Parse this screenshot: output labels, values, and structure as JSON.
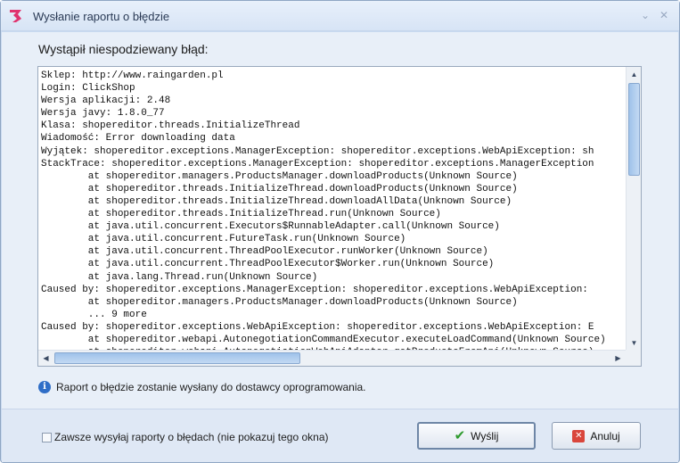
{
  "window": {
    "title": "Wysłanie raportu o błędzie",
    "minimize_glyph": "⌄",
    "close_glyph": "✕"
  },
  "heading": "Wystąpił niespodziewany błąd:",
  "report_lines": [
    "Sklep: http://www.raingarden.pl",
    "Login: ClickShop",
    "Wersja aplikacji: 2.48",
    "Wersja javy: 1.8.0_77",
    "Klasa: shopereditor.threads.InitializeThread",
    "Wiadomość: Error downloading data",
    "Wyjątek: shopereditor.exceptions.ManagerException: shopereditor.exceptions.WebApiException: sh",
    "StackTrace: shopereditor.exceptions.ManagerException: shopereditor.exceptions.ManagerException",
    "        at shopereditor.managers.ProductsManager.downloadProducts(Unknown Source)",
    "        at shopereditor.threads.InitializeThread.downloadProducts(Unknown Source)",
    "        at shopereditor.threads.InitializeThread.downloadAllData(Unknown Source)",
    "        at shopereditor.threads.InitializeThread.run(Unknown Source)",
    "        at java.util.concurrent.Executors$RunnableAdapter.call(Unknown Source)",
    "        at java.util.concurrent.FutureTask.run(Unknown Source)",
    "        at java.util.concurrent.ThreadPoolExecutor.runWorker(Unknown Source)",
    "        at java.util.concurrent.ThreadPoolExecutor$Worker.run(Unknown Source)",
    "        at java.lang.Thread.run(Unknown Source)",
    "Caused by: shopereditor.exceptions.ManagerException: shopereditor.exceptions.WebApiException:",
    "        at shopereditor.managers.ProductsManager.downloadProducts(Unknown Source)",
    "        ... 9 more",
    "Caused by: shopereditor.exceptions.WebApiException: shopereditor.exceptions.WebApiException: E",
    "        at shopereditor.webapi.AutonegotiationCommandExecutor.executeLoadCommand(Unknown Source)",
    "        at shopereditor.webapi.AutonegotiationWebApiAdapter.getProductsFromApi(Unknown Source)"
  ],
  "info_text": "Raport o błędzie zostanie wysłany do dostawcy oprogramowania.",
  "always_send": {
    "label": "Zawsze wysyłaj raporty o błędach (nie pokazuj tego okna)",
    "checked": false
  },
  "buttons": {
    "send_label": "Wyślij",
    "cancel_label": "Anuluj"
  },
  "icons": {
    "app": "shoper-logo-icon",
    "info": "info-icon",
    "send": "checkmark-icon",
    "cancel": "close-icon"
  },
  "colors": {
    "accent": "#2f6ec7",
    "send_check": "#2e9a2e",
    "cancel_x": "#d9463c",
    "logo": "#e0336e"
  }
}
